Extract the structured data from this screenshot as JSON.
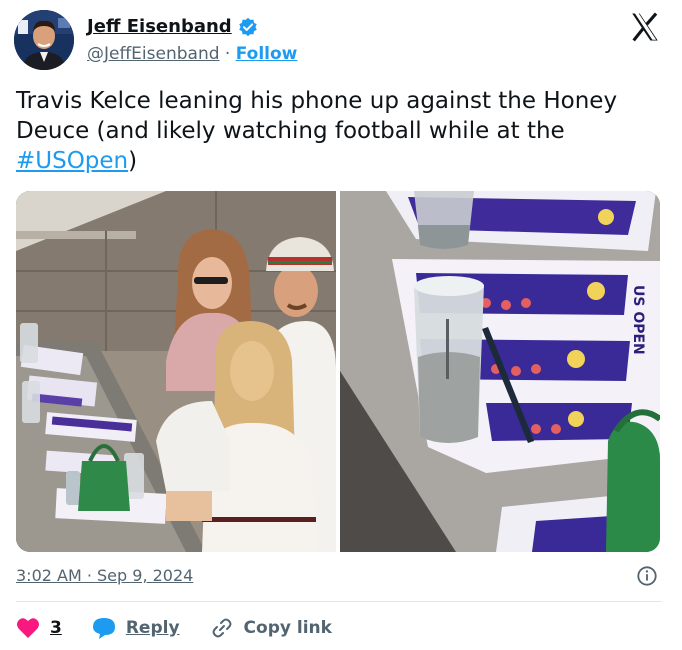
{
  "author": {
    "name": "Jeff Eisenband",
    "handle": "@JeffEisenband",
    "separator": "·",
    "follow_label": "Follow",
    "verified": true,
    "avatar_icon": "avatar-photo",
    "verified_color": "#1d9bf0"
  },
  "post": {
    "text_before": "Travis Kelce leaning his phone up against the Honey Deuce (and likely watching football while at the ",
    "hashtag": "#USOpen",
    "text_after": ")",
    "media": [
      {
        "description_icon": "photo-couple-in-suite"
      },
      {
        "description_icon": "photo-drink-on-program"
      }
    ],
    "program_text": "US OPEN"
  },
  "meta": {
    "timestamp": "3:02 AM · Sep 9, 2024",
    "info_icon": "info-icon"
  },
  "actions": {
    "like_count": "3",
    "reply_label": "Reply",
    "copy_label": "Copy link"
  },
  "colors": {
    "accent": "#1d9bf0",
    "like": "#f91880",
    "text": "#0f1419",
    "secondary": "#536471"
  }
}
